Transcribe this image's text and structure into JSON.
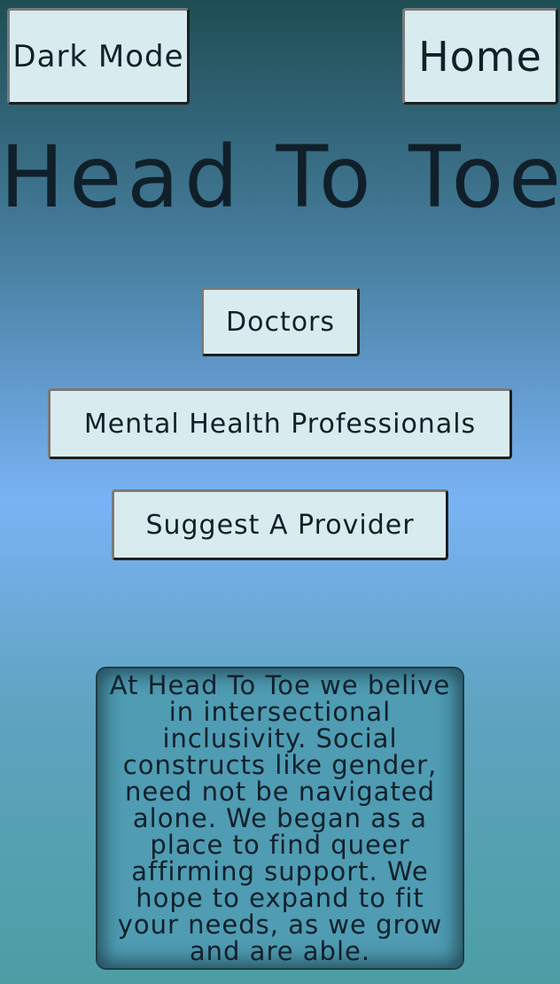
{
  "header": {
    "dark_mode_label": "Dark Mode",
    "home_label": "Home"
  },
  "title": "Head To Toe",
  "nav": {
    "doctors_label": "Doctors",
    "mental_health_label": "Mental Health Professionals",
    "suggest_label": "Suggest A Provider"
  },
  "about": {
    "text": "At Head To Toe we belive in intersectional inclusivity. Social constructs like gender, need not be navigated alone. We began as a place to find queer affirming support. We hope to expand to fit your needs, as we grow and are able."
  },
  "colors": {
    "button_bg": "#d8ecef",
    "text": "#122027",
    "gradient_top": "#1e4d53",
    "gradient_mid": "#7ab3f5",
    "gradient_bottom": "#4c9ea4"
  }
}
